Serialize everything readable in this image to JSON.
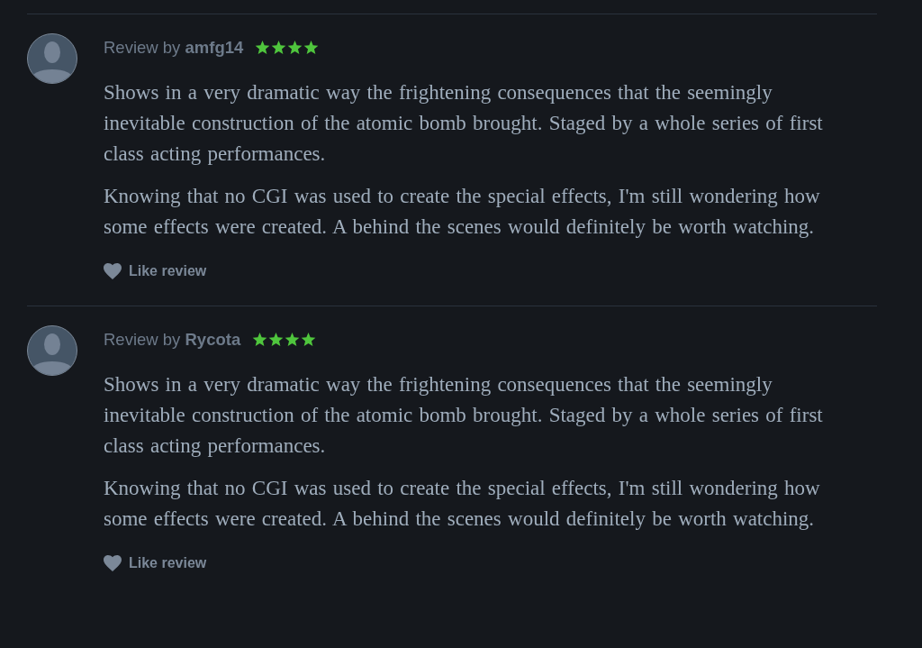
{
  "reviews": [
    {
      "byline": "Review by **amfg14**",
      "stars": 4,
      "paragraphs": [
        "Shows in a very dramatic way the frightening consequences that the seemingly inevitable construction of the atomic bomb brought. Staged by a whole series of first class acting performances.",
        "Knowing that no CGI was used to create the special effects, I'm still wondering how some effects were created. A behind the scenes would definitely be worth watching."
      ],
      "like": "Like review"
    },
    {
      "byline": "Review by **Rycota**",
      "stars": 4,
      "paragraphs": [
        "Shows in a very dramatic way the frightening consequences that the seemingly inevitable construction of the atomic bomb brought. Staged by a whole series of first class acting performances.",
        "Knowing that no CGI was used to create the special effects, I'm still wondering how some effects were created. A behind the scenes would definitely be worth watching."
      ],
      "like": "Like review"
    }
  ]
}
